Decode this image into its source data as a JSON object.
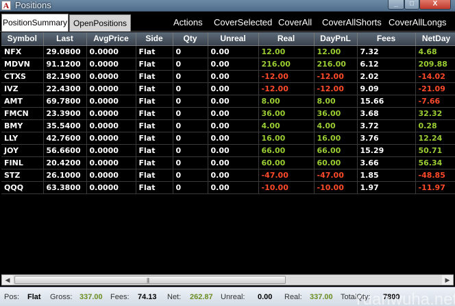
{
  "window": {
    "title": "Positions",
    "icon_letter": "A",
    "min_label": "_",
    "max_label": "□",
    "close_label": "X"
  },
  "tabs": [
    {
      "label": "PositionSummary",
      "active": true
    },
    {
      "label": "OpenPositions",
      "active": false
    }
  ],
  "actions": [
    "Actions",
    "CoverSelected",
    "CoverAll",
    "CoverAllShorts",
    "CoverAllLongs"
  ],
  "columns": [
    "Symbol",
    "Last",
    "AvgPrice",
    "Side",
    "Qty",
    "Unreal",
    "Real",
    "DayPnL",
    "Fees",
    "NetDay"
  ],
  "rows": [
    [
      "NFX",
      "29.0800",
      "0.0000",
      "Flat",
      "0",
      "0.00",
      "12.00",
      "12.00",
      "7.32",
      "4.68"
    ],
    [
      "MDVN",
      "91.1200",
      "0.0000",
      "Flat",
      "0",
      "0.00",
      "216.00",
      "216.00",
      "6.12",
      "209.88"
    ],
    [
      "CTXS",
      "82.1900",
      "0.0000",
      "Flat",
      "0",
      "0.00",
      "-12.00",
      "-12.00",
      "2.02",
      "-14.02"
    ],
    [
      "IVZ",
      "22.4300",
      "0.0000",
      "Flat",
      "0",
      "0.00",
      "-12.00",
      "-12.00",
      "9.09",
      "-21.09"
    ],
    [
      "AMT",
      "69.7800",
      "0.0000",
      "Flat",
      "0",
      "0.00",
      "8.00",
      "8.00",
      "15.66",
      "-7.66"
    ],
    [
      "FMCN",
      "23.3900",
      "0.0000",
      "Flat",
      "0",
      "0.00",
      "36.00",
      "36.00",
      "3.68",
      "32.32"
    ],
    [
      "BMY",
      "35.5400",
      "0.0000",
      "Flat",
      "0",
      "0.00",
      "4.00",
      "4.00",
      "3.72",
      "0.28"
    ],
    [
      "LLY",
      "42.7600",
      "0.0000",
      "Flat",
      "0",
      "0.00",
      "16.00",
      "16.00",
      "3.76",
      "12.24"
    ],
    [
      "JOY",
      "56.6600",
      "0.0000",
      "Flat",
      "0",
      "0.00",
      "66.00",
      "66.00",
      "15.29",
      "50.71"
    ],
    [
      "FINL",
      "20.4200",
      "0.0000",
      "Flat",
      "0",
      "0.00",
      "60.00",
      "60.00",
      "3.66",
      "56.34"
    ],
    [
      "STZ",
      "26.1000",
      "0.0000",
      "Flat",
      "0",
      "0.00",
      "-47.00",
      "-47.00",
      "1.85",
      "-48.85"
    ],
    [
      "QQQ",
      "63.3800",
      "0.0000",
      "Flat",
      "0",
      "0.00",
      "-10.00",
      "-10.00",
      "1.97",
      "-11.97"
    ]
  ],
  "colors": {
    "positive": "#9acd32",
    "negative": "#ff4a2a",
    "background": "#000000",
    "header": "#4a5562"
  },
  "scrollbar": {
    "left_arrow": "◀",
    "right_arrow": "▶",
    "grip": "|||"
  },
  "status": {
    "pos_label": "Pos:",
    "pos_value": "Flat",
    "gross_label": "Gross:",
    "gross_value": "337.00",
    "fees_label": "Fees:",
    "fees_value": "74.13",
    "net_label": "Net:",
    "net_value": "262.87",
    "unreal_label": "Unreal:",
    "unreal_value": "0.00",
    "real_label": "Real:",
    "real_value": "337.00",
    "totalqty_label": "TotalQty:",
    "totalqty_value": "7800"
  },
  "watermark": "Yuanwuha.net"
}
